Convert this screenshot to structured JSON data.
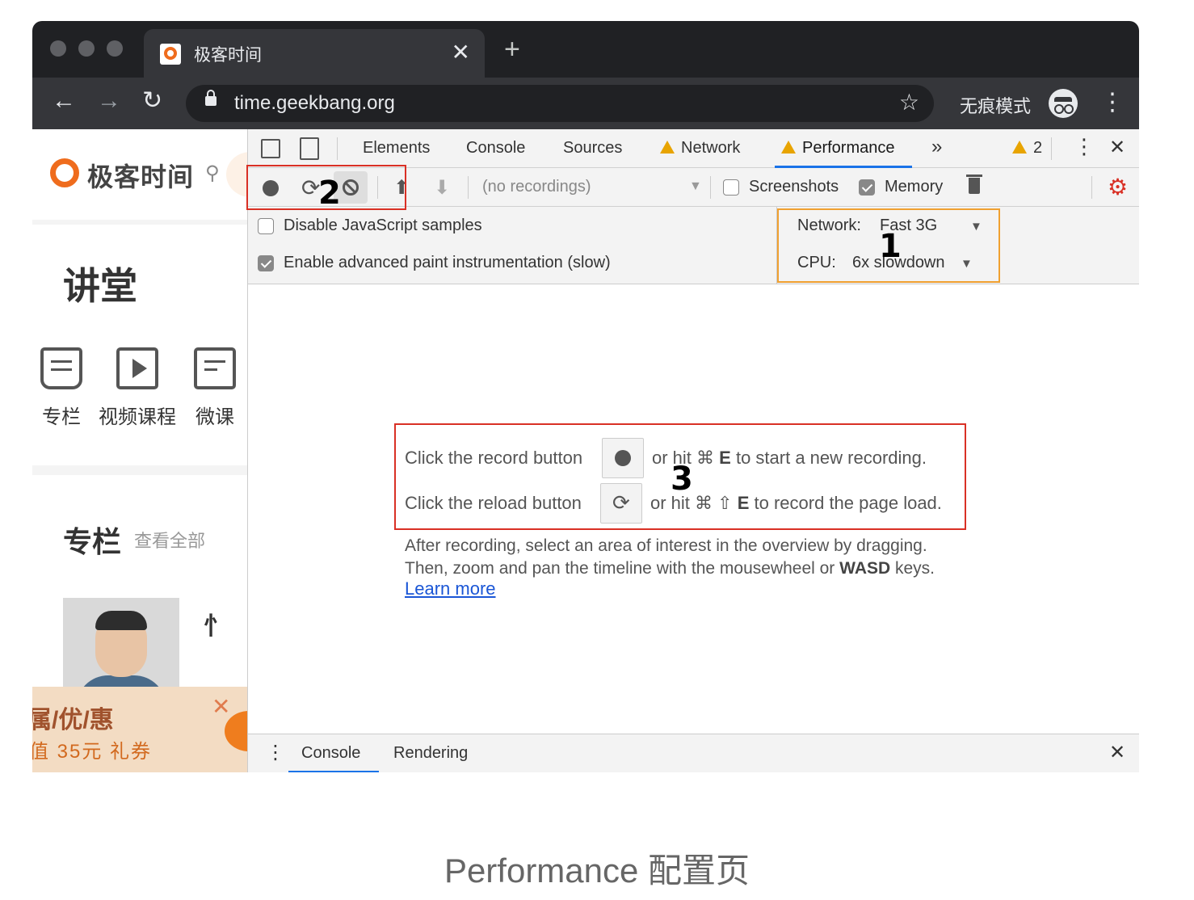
{
  "browser": {
    "tab_title": "极客时间",
    "tab_close": "✕",
    "new_tab": "+",
    "url": "time.geekbang.org",
    "incognito_label": "无痕模式",
    "back": "←",
    "forward": "→",
    "reload": "↻",
    "star": "☆",
    "menu": "⋮"
  },
  "page": {
    "logo_text": "极客时间",
    "section_title": "讲堂",
    "categories": [
      {
        "label": "专栏"
      },
      {
        "label": "视频课程"
      },
      {
        "label": "微课"
      }
    ],
    "column_title": "专栏",
    "column_more": "查看全部",
    "promo_line1": "属/优/惠",
    "promo_line2": "值 35元 礼券"
  },
  "devtools": {
    "tabs": [
      "Elements",
      "Console",
      "Sources",
      "Network",
      "Performance"
    ],
    "more_tabs": "»",
    "warning_count": "2",
    "close": "✕",
    "recordings_placeholder": "(no recordings)",
    "screenshots_label": "Screenshots",
    "memory_label": "Memory",
    "disable_js_label": "Disable JavaScript samples",
    "paint_label": "Enable advanced paint instrumentation (slow)",
    "network_label": "Network:",
    "network_value": "Fast 3G",
    "cpu_label": "CPU:",
    "cpu_value": "6x slowdown",
    "instr": {
      "record_pre": "Click the record button",
      "record_post_1": "or hit ⌘",
      "record_key": "E",
      "record_post_2": "to start a new recording.",
      "reload_pre": "Click the reload button",
      "reload_post_1": "or hit ⌘ ⇧",
      "reload_key": "E",
      "reload_post_2": "to record the page load.",
      "after_1": "After recording, select an area of interest in the overview by dragging.",
      "after_2_pre": "Then, zoom and pan the timeline with the mousewheel or",
      "after_2_key": "WASD",
      "after_2_post": "keys.",
      "learn_more": "Learn more"
    },
    "drawer_tabs": [
      "Console",
      "Rendering"
    ]
  },
  "annotations": {
    "label_1": "1",
    "label_2": "2",
    "label_3": "3",
    "color_red": "#d93025",
    "color_orange": "#f0a030"
  },
  "caption": "Performance 配置页"
}
